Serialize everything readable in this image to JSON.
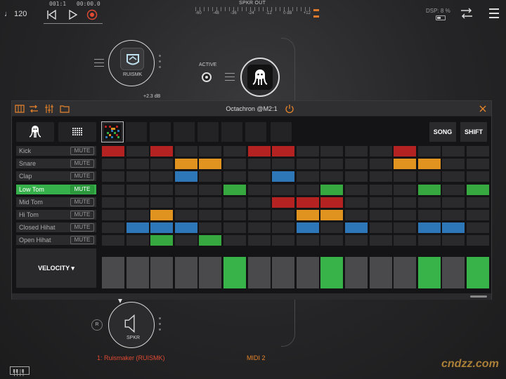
{
  "topbar": {
    "tempo": "♩ 120",
    "position_bars": "001:1",
    "position_time": "00:00.0",
    "meter_title": "SPKR OUT",
    "meter_scale": [
      "-60",
      "-48",
      "-36",
      "-24",
      "-12",
      "0 dB",
      "+12"
    ],
    "dsp_label": "DSP: 8 %"
  },
  "nodes": {
    "ruismk_label": "RUISMK",
    "ruismk_gain": "+2.3 dB",
    "active_label": "ACTIVE",
    "spkr_label": "SPKR",
    "r_button": "R"
  },
  "plugin": {
    "title": "Octachron @M2:1",
    "song_label": "SONG",
    "shift_label": "SHIFT",
    "velocity_label": "VELOCITY ▾",
    "instruments": [
      {
        "name": "Kick",
        "mute": "MUTE"
      },
      {
        "name": "Snare",
        "mute": "MUTE"
      },
      {
        "name": "Clap",
        "mute": "MUTE"
      },
      {
        "name": "Low Tom",
        "mute": "MUTE"
      },
      {
        "name": "Mid Tom",
        "mute": "MUTE"
      },
      {
        "name": "Hi Tom",
        "mute": "MUTE"
      },
      {
        "name": "Closed Hihat",
        "mute": "MUTE"
      },
      {
        "name": "Open Hihat",
        "mute": "MUTE"
      }
    ],
    "selected_instrument": 3,
    "steps": [
      [
        1,
        0,
        1,
        0,
        0,
        0,
        1,
        1,
        0,
        0,
        0,
        0,
        1,
        0,
        0,
        0
      ],
      [
        0,
        0,
        0,
        1,
        1,
        0,
        0,
        0,
        0,
        0,
        0,
        0,
        1,
        1,
        0,
        0
      ],
      [
        0,
        0,
        0,
        1,
        0,
        0,
        0,
        1,
        0,
        0,
        0,
        0,
        0,
        0,
        0,
        0
      ],
      [
        0,
        0,
        0,
        0,
        0,
        1,
        0,
        0,
        0,
        1,
        0,
        0,
        0,
        1,
        0,
        1
      ],
      [
        0,
        0,
        0,
        0,
        0,
        0,
        0,
        1,
        1,
        1,
        0,
        0,
        0,
        0,
        0,
        0
      ],
      [
        0,
        0,
        1,
        0,
        0,
        0,
        0,
        0,
        1,
        1,
        0,
        0,
        0,
        0,
        0,
        0
      ],
      [
        0,
        1,
        1,
        1,
        0,
        0,
        0,
        0,
        1,
        0,
        1,
        0,
        0,
        1,
        1,
        0
      ],
      [
        0,
        0,
        1,
        0,
        1,
        0,
        0,
        0,
        0,
        0,
        0,
        0,
        0,
        0,
        0,
        0
      ]
    ],
    "row_colors": [
      "#b52222",
      "#e0941f",
      "#2d77b8",
      "#36a83f",
      "#b52222",
      "#e0941f",
      "#2d77b8",
      "#36a83f"
    ],
    "velocity_steps": [
      0,
      0,
      0,
      0,
      0,
      1,
      0,
      0,
      0,
      1,
      0,
      0,
      0,
      1,
      0,
      1
    ]
  },
  "bottom": {
    "channel1": "1: Ruismaker (RUISMK)",
    "channel2": "MIDI 2"
  },
  "watermark": "cndzz.com",
  "colors": {
    "accent_orange": "#e8842a",
    "step_green": "#36b04a",
    "record_red": "#e24a33"
  }
}
